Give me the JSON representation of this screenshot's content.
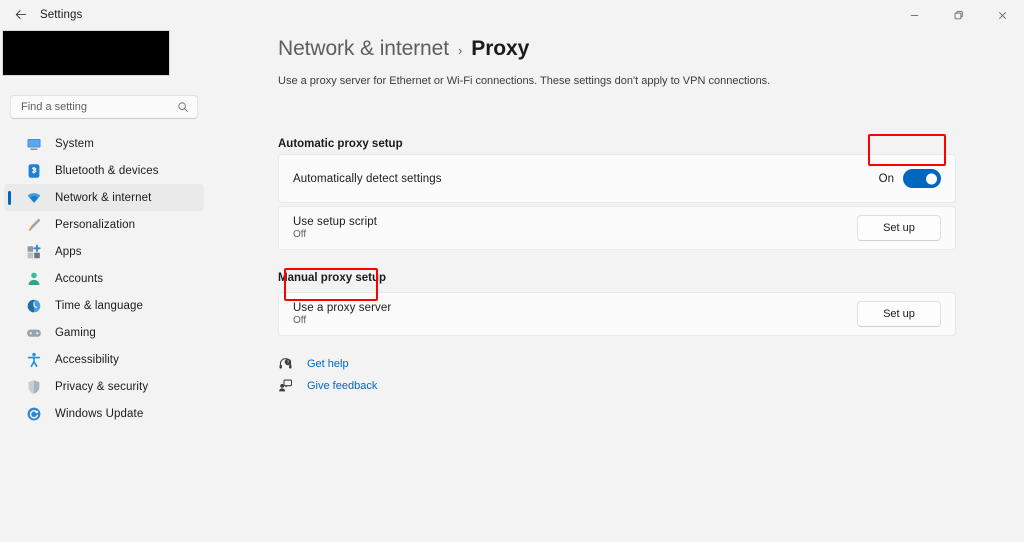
{
  "window": {
    "title": "Settings",
    "back_icon": "back-arrow-icon",
    "controls": {
      "minimize": "–",
      "maximize": "❑",
      "close": "✕"
    }
  },
  "sidebar": {
    "profile_redacted": "",
    "search": {
      "placeholder": "Find a setting",
      "value": "",
      "icon": "search-icon"
    },
    "items": [
      {
        "label": "System",
        "icon": "monitor-icon",
        "selected": false
      },
      {
        "label": "Bluetooth & devices",
        "icon": "bluetooth-icon",
        "selected": false
      },
      {
        "label": "Network & internet",
        "icon": "wifi-icon",
        "selected": true
      },
      {
        "label": "Personalization",
        "icon": "paintbrush-icon",
        "selected": false
      },
      {
        "label": "Apps",
        "icon": "apps-grid-icon",
        "selected": false
      },
      {
        "label": "Accounts",
        "icon": "person-icon",
        "selected": false
      },
      {
        "label": "Time & language",
        "icon": "clock-globe-icon",
        "selected": false
      },
      {
        "label": "Gaming",
        "icon": "gamepad-icon",
        "selected": false
      },
      {
        "label": "Accessibility",
        "icon": "accessibility-person-icon",
        "selected": false
      },
      {
        "label": "Privacy & security",
        "icon": "shield-icon",
        "selected": false
      },
      {
        "label": "Windows Update",
        "icon": "update-refresh-icon",
        "selected": false
      }
    ]
  },
  "main": {
    "breadcrumb": {
      "parent": "Network & internet",
      "separator": "›",
      "current": "Proxy"
    },
    "description": "Use a proxy server for Ethernet or Wi-Fi connections. These settings don't apply to VPN connections.",
    "sections": [
      {
        "title": "Automatic proxy setup",
        "rows": [
          {
            "title": "Automatically detect settings",
            "subtitle": "",
            "control": "toggle",
            "toggle_state": "On"
          },
          {
            "title": "Use setup script",
            "subtitle": "Off",
            "control": "button",
            "button_label": "Set up"
          }
        ]
      },
      {
        "title": "Manual proxy setup",
        "rows": [
          {
            "title": "Use a proxy server",
            "subtitle": "Off",
            "control": "button",
            "button_label": "Set up"
          }
        ]
      }
    ],
    "footer_links": [
      {
        "label": "Get help",
        "icon": "help-headset-icon"
      },
      {
        "label": "Give feedback",
        "icon": "feedback-person-icon"
      }
    ]
  },
  "annotations": {
    "accent_color": "#ff0000",
    "toggle_highlight": "Automatically detect settings toggle",
    "proxy_highlight": "Use a proxy server label"
  },
  "colors": {
    "accent": "#0067c0",
    "link": "#0067c0",
    "annotation": "#ff0000",
    "background": "#f3f3f3",
    "card": "#fbfbfb"
  }
}
